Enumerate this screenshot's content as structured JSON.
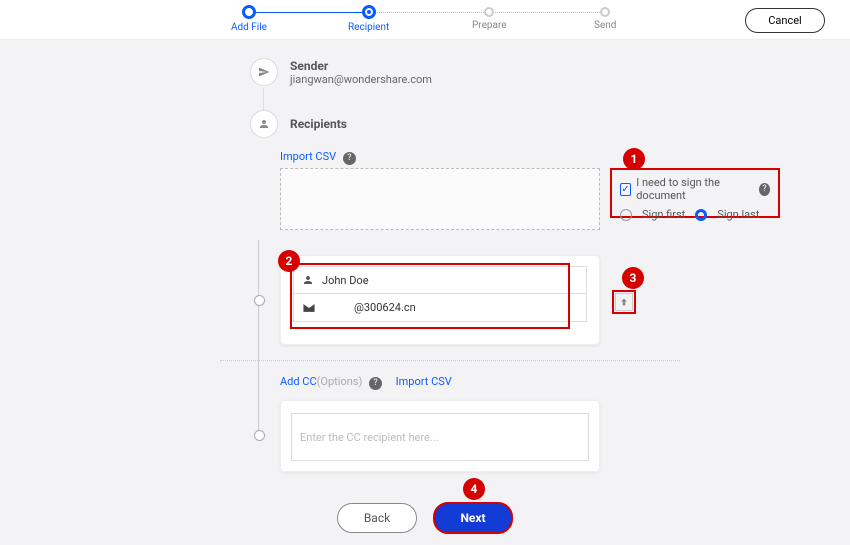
{
  "stepper": {
    "steps": [
      "Add File",
      "Recipient",
      "Prepare",
      "Send"
    ],
    "active_index": 1
  },
  "cancel_label": "Cancel",
  "sender": {
    "title": "Sender",
    "email": "jiangwan@wondershare.com"
  },
  "recipients_title": "Recipients",
  "import_csv_label": "Import CSV",
  "self_sign": {
    "checkbox_label": "I need to sign the document",
    "checked": true,
    "option_first": "Sign first",
    "option_last": "Sign last",
    "selected": "last"
  },
  "recipient": {
    "name": "John Doe",
    "email": "@300624.cn"
  },
  "cc": {
    "add_label": "Add CC",
    "options_suffix": "(Options)",
    "import_label": "Import CSV",
    "placeholder": "Enter the CC recipient here..."
  },
  "footer": {
    "back": "Back",
    "next": "Next"
  },
  "callouts": {
    "c1": "1",
    "c2": "2",
    "c3": "3",
    "c4": "4"
  }
}
